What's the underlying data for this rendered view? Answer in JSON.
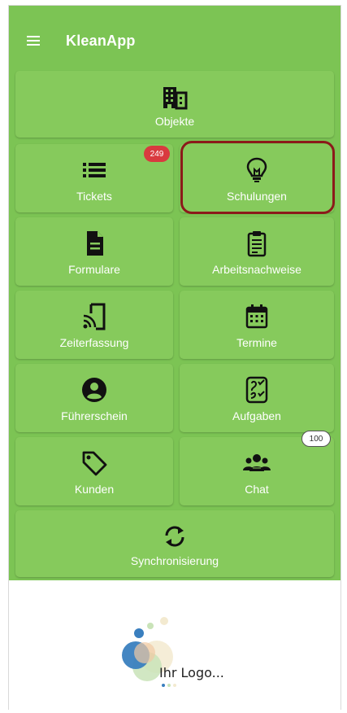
{
  "app": {
    "title": "KleanApp"
  },
  "tiles": {
    "objekte": {
      "label": "Objekte",
      "icon": "building-icon"
    },
    "tickets": {
      "label": "Tickets",
      "icon": "list-icon",
      "badge": "249"
    },
    "schulungen": {
      "label": "Schulungen",
      "icon": "lightbulb-icon"
    },
    "formulare": {
      "label": "Formulare",
      "icon": "document-icon"
    },
    "arbeitsnachweise": {
      "label": "Arbeitsnachweise",
      "icon": "clipboard-icon"
    },
    "zeiterfassung": {
      "label": "Zeiterfassung",
      "icon": "phone-nfc-icon"
    },
    "termine": {
      "label": "Termine",
      "icon": "calendar-icon"
    },
    "fuehrerschein": {
      "label": "Führerschein",
      "icon": "account-circle-icon"
    },
    "aufgaben": {
      "label": "Aufgaben",
      "icon": "checklist-icon"
    },
    "kunden": {
      "label": "Kunden",
      "icon": "tag-icon"
    },
    "chat": {
      "label": "Chat",
      "icon": "group-icon",
      "badge": "100"
    },
    "synchronisierung": {
      "label": "Synchronisierung",
      "icon": "sync-icon"
    }
  },
  "logo": {
    "text": "Ihr Logo..."
  },
  "colors": {
    "primary": "#7cc454",
    "tile": "#86ca5c",
    "badge_red": "#d93a3f",
    "highlight": "#8b1a1a"
  }
}
